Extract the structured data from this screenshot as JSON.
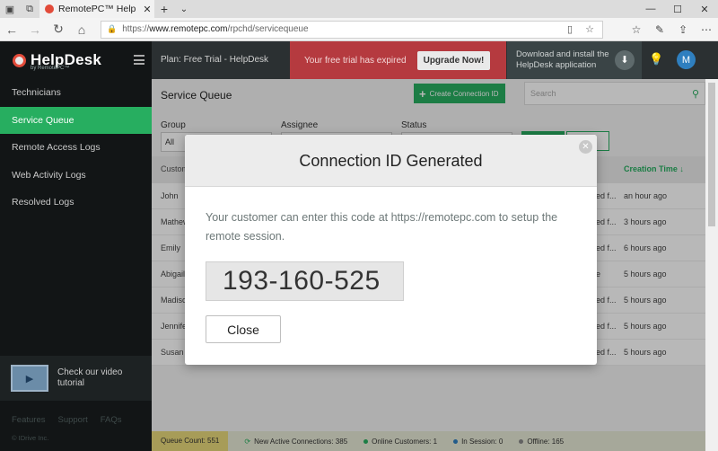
{
  "browser": {
    "tab_title": "RemotePC™ HelpDesk -",
    "url_prefix": "https://",
    "url_domain": "www.remotepc.com",
    "url_path": "/rpchd/servicequeue",
    "icons": [
      "tab-actions-icon",
      "back-icon",
      "forward-icon",
      "refresh-icon",
      "home-icon",
      "lock-icon",
      "reading-view-icon",
      "favorite-star-icon",
      "favorites-icon",
      "notes-icon",
      "share-icon",
      "more-icon"
    ]
  },
  "sidebar": {
    "logo": "HelpDesk",
    "logo_sub": "by RemotePC™",
    "items": [
      {
        "label": "Technicians"
      },
      {
        "label": "Service Queue"
      },
      {
        "label": "Remote Access Logs"
      },
      {
        "label": "Web Activity Logs"
      },
      {
        "label": "Resolved Logs"
      }
    ],
    "promo": "Check our video tutorial",
    "footer_links": [
      "Features",
      "Support",
      "FAQs"
    ],
    "copyright": "© IDrive Inc."
  },
  "topbar": {
    "plan": "Plan: Free Trial - HelpDesk",
    "trial_msg": "Your free trial has expired",
    "upgrade": "Upgrade Now!",
    "download": "Download and install the HelpDesk application",
    "avatar": "M"
  },
  "queue": {
    "title": "Service Queue",
    "create_btn": "Create Connection ID",
    "search_placeholder": "Search",
    "filters": {
      "group_label": "Group",
      "group_value": "All",
      "assignee_label": "Assignee",
      "status_label": "Status"
    },
    "columns": [
      "Custom",
      "Creation Time"
    ],
    "rows": [
      {
        "name": "John",
        "status": "ed f...",
        "time": "an hour ago"
      },
      {
        "name": "Mathew",
        "status": "ed f...",
        "time": "3 hours ago"
      },
      {
        "name": "Emily",
        "status": "ed f...",
        "time": "6 hours ago"
      },
      {
        "name": "Abigail",
        "status": "e",
        "time": "5 hours ago"
      },
      {
        "name": "Madison",
        "status": "ed f...",
        "time": "5 hours ago"
      },
      {
        "name": "Jennifer",
        "status": "ed f...",
        "time": "5 hours ago"
      },
      {
        "name": "Susan",
        "status": "ed f...",
        "time": "5 hours ago"
      }
    ]
  },
  "statusbar": {
    "queue_count": "Queue Count: 551",
    "active_connections": "New Active Connections: 385",
    "online": "Online Customers: 1",
    "in_session": "In Session: 0",
    "offline": "Offline: 165"
  },
  "modal": {
    "title": "Connection ID Generated",
    "message": "Your customer can enter this code at https://remotepc.com to setup the remote session.",
    "code": "193-160-525",
    "close_label": "Close"
  },
  "colors": {
    "accent": "#27ae60",
    "danger": "#b53a3f",
    "sidebar": "#121516"
  }
}
